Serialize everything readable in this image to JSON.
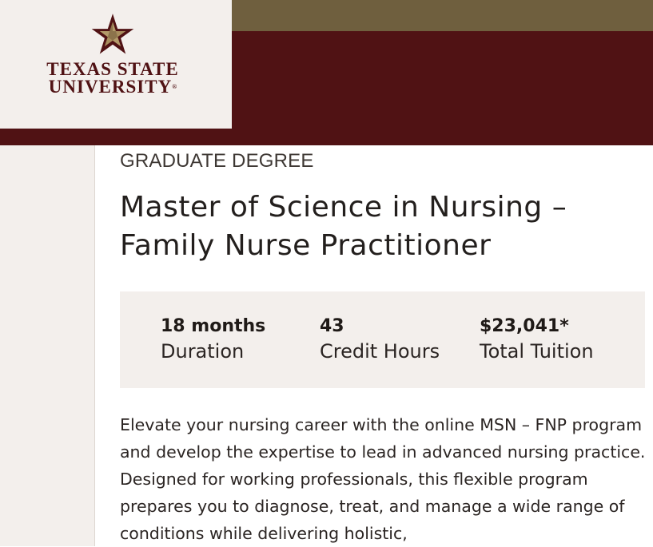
{
  "header": {
    "logo": {
      "line1": "TEXAS STATE",
      "line2": "UNIVERSITY",
      "registered_mark": "®",
      "icon": "star-logo-icon",
      "colors": {
        "maroon": "#501214",
        "gold": "#8c734b",
        "cream": "#f3efec"
      }
    },
    "colors": {
      "gold_bar": "#6f5f3e",
      "maroon_band": "#501214"
    }
  },
  "main": {
    "eyebrow": "GRADUATE DEGREE",
    "title": "Master of Science in Nursing – Family Nurse Practitioner",
    "stats": [
      {
        "value": "18 months",
        "label": "Duration"
      },
      {
        "value": "43",
        "label": "Credit Hours"
      },
      {
        "value": "$23,041*",
        "label": "Total Tuition"
      }
    ],
    "description": "Elevate your nursing career with the online MSN – FNP program and develop the expertise to lead in advanced nursing practice. Designed for working professionals, this flexible program prepares you to diagnose, treat, and manage a wide range of conditions while delivering holistic,"
  }
}
